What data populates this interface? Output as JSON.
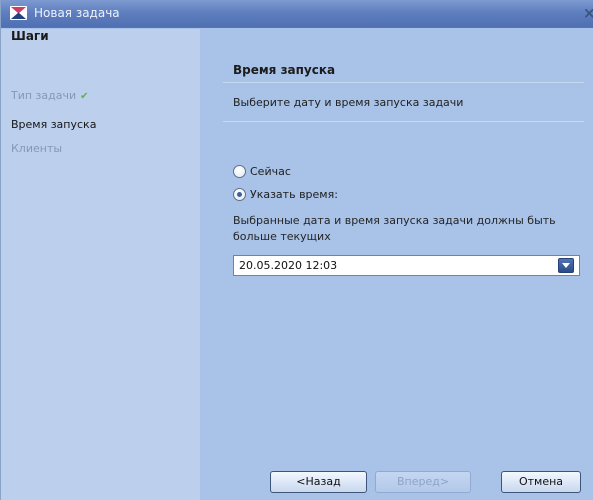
{
  "window": {
    "title": "Новая задача"
  },
  "sidebar": {
    "title": "Шаги",
    "steps": [
      {
        "label": "Тип задачи",
        "state": "done"
      },
      {
        "label": "Время запуска",
        "state": "current"
      },
      {
        "label": "Клиенты",
        "state": "future"
      }
    ]
  },
  "main": {
    "section_title": "Время запуска",
    "subtitle": "Выберите дату и время запуска задачи",
    "radio_now": "Сейчас",
    "radio_specify": "Указать время:",
    "selected_option": "Указать время:",
    "note": "Выбранные дата и время запуска задачи должны быть больше текущих",
    "datetime_value": "20.05.2020 12:03"
  },
  "buttons": {
    "back": "<Назад",
    "next": "Вперед>",
    "cancel": "Отмена"
  },
  "colors": {
    "sidebar_bg": "#bcd0ed",
    "content_bg": "#a8c2e8",
    "titlebar": "#5f7fbf",
    "check": "#5fb34c"
  }
}
